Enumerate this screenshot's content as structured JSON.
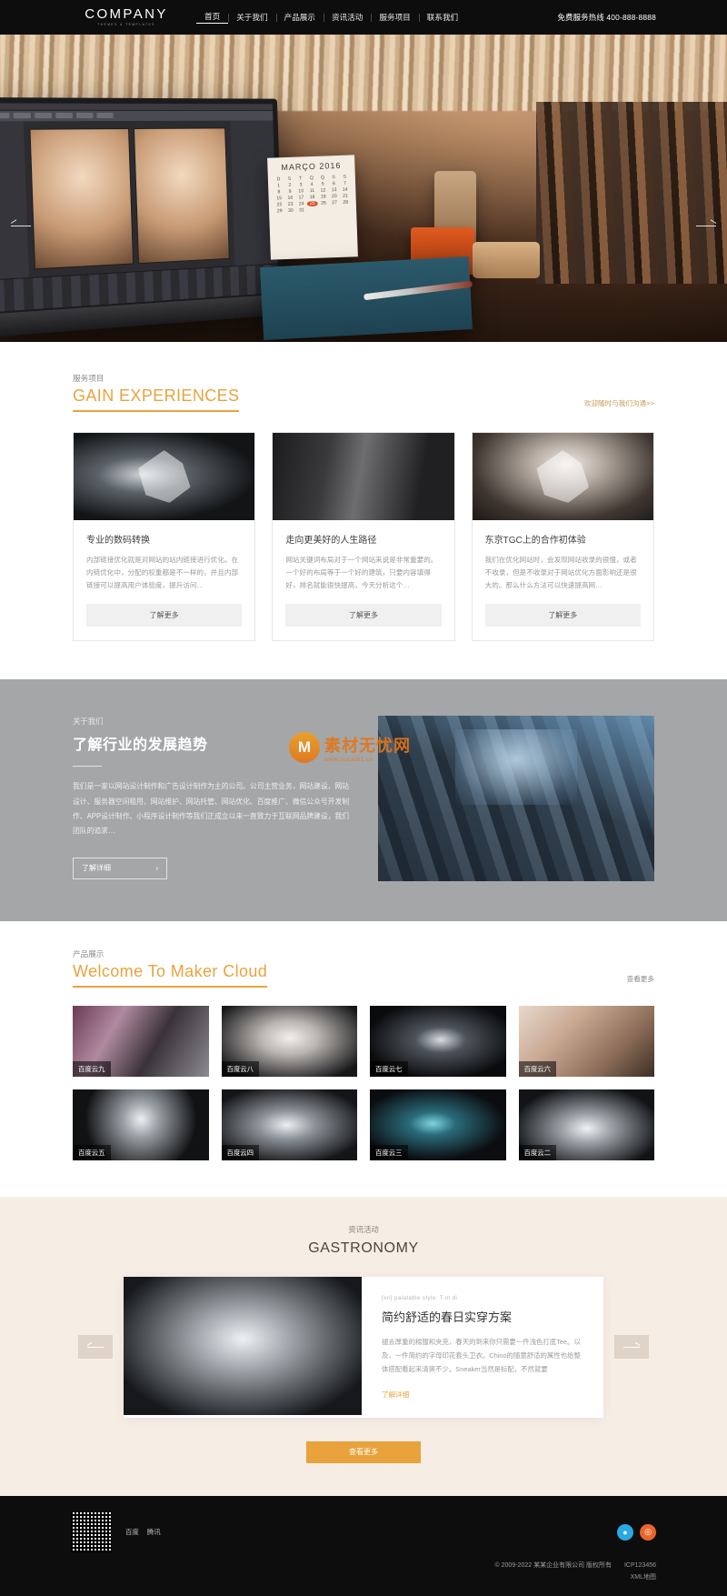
{
  "header": {
    "logo": "COMPANY",
    "logo_sub": "THEMES & TEMPLATES",
    "nav": [
      {
        "label": "首页",
        "active": true
      },
      {
        "label": "关于我们",
        "active": false
      },
      {
        "label": "产品展示",
        "active": false
      },
      {
        "label": "资讯活动",
        "active": false
      },
      {
        "label": "服务项目",
        "active": false
      },
      {
        "label": "联系我们",
        "active": false
      }
    ],
    "hotline": "免费服务热线 400-888-8888"
  },
  "hero": {
    "prev_icon": "arrow-left-icon",
    "next_icon": "arrow-right-icon",
    "calendar_title": "MARÇO 2016",
    "calendar_days": [
      "D",
      "S",
      "T",
      "Q",
      "Q",
      "S",
      "S",
      "1",
      "2",
      "3",
      "4",
      "5",
      "6",
      "7",
      "8",
      "9",
      "10",
      "11",
      "12",
      "13",
      "14",
      "15",
      "16",
      "17",
      "18",
      "19",
      "20",
      "21",
      "22",
      "23",
      "24",
      "25",
      "26",
      "27",
      "28",
      "29",
      "30",
      "31"
    ],
    "calendar_highlight": "25"
  },
  "services": {
    "label": "服务项目",
    "title": "GAIN EXPERIENCES",
    "more": "欢迎随时与我们沟通>>",
    "cards": [
      {
        "title": "专业的数码转换",
        "desc": "内部链接优化就是对网站的站内链接进行优化。在内链优化中，分配的权重都是不一样的，并且内部链接可以提高用户体验度，提升访问…",
        "button": "了解更多"
      },
      {
        "title": "走向更美好的人生路径",
        "desc": "网站关键词布局对于一个网站来说是非常重要的。一个好的布局等于一个好的建筑，只要内容填得好，排名就能很快提高，今天分析这个…",
        "button": "了解更多"
      },
      {
        "title": "东京TGC上的合作初体验",
        "desc": "我们在优化网站时，会发现网站收录的很慢，或者不收录，但是不收录对于网站优化方面影响还是很大的。那么什么方法可以快速提高网…",
        "button": "了解更多"
      }
    ]
  },
  "about": {
    "label": "关于我们",
    "title": "了解行业的发展趋势",
    "desc": "我们是一家以网站设计制作和广告设计制作为主的公司。公司主营业务，网站建设，网站设计、服务器空间租用、网站维护、网站托管、网站优化、百度推广、微信公众号开发制作、APP设计制作、小程序设计制作等我们正成立以来一直致力于互联网品牌建设，我们团队的追求…",
    "button": "了解详细",
    "button_icon": "chevron-right-icon",
    "watermark_name": "素材无忧网",
    "watermark_url": "www.sucai51.cn"
  },
  "products": {
    "label": "产品展示",
    "title": "Welcome To Maker Cloud",
    "more": "查看更多",
    "items": [
      {
        "caption": "百度云九"
      },
      {
        "caption": "百度云八"
      },
      {
        "caption": "百度云七"
      },
      {
        "caption": "百度云六"
      },
      {
        "caption": "百度云五"
      },
      {
        "caption": "百度云四"
      },
      {
        "caption": "百度云三"
      },
      {
        "caption": "百度云二"
      }
    ]
  },
  "news": {
    "label": "资讯活动",
    "title": "GASTRONOMY",
    "prev_icon": "arrow-left-icon",
    "next_icon": "arrow-right-icon",
    "article": {
      "meta": "[en] palatable style: T-m di",
      "title": "简约舒适的春日实穿方案",
      "body": "褪去厚重的棉服和夹克，春天的到来你只需要一件浅色打底Tee。以及，一件简约的字母印花套头卫衣。Chino的随意舒适的属性也给整体搭配看起来清爽不少。Sneaker当然是标配，不然就要",
      "link": "了解详细"
    },
    "more_button": "查看更多"
  },
  "footer": {
    "qr_alt": "qr-code",
    "links": [
      "百度",
      "腾讯"
    ],
    "socials": [
      {
        "name": "qq-icon",
        "glyph": "◉",
        "color": "#2aa8e0"
      },
      {
        "name": "weibo-icon",
        "glyph": "◎",
        "color": "#e8662a"
      }
    ],
    "copyright": "© 2009-2022 某某企业有限公司 版权所有",
    "icp": "ICP123456",
    "xml": "XML地图"
  },
  "colors": {
    "accent": "#e8a33d",
    "header_bg": "#0d0d0d",
    "about_bg": "#a5a6a8",
    "news_bg": "#f6ede4"
  }
}
